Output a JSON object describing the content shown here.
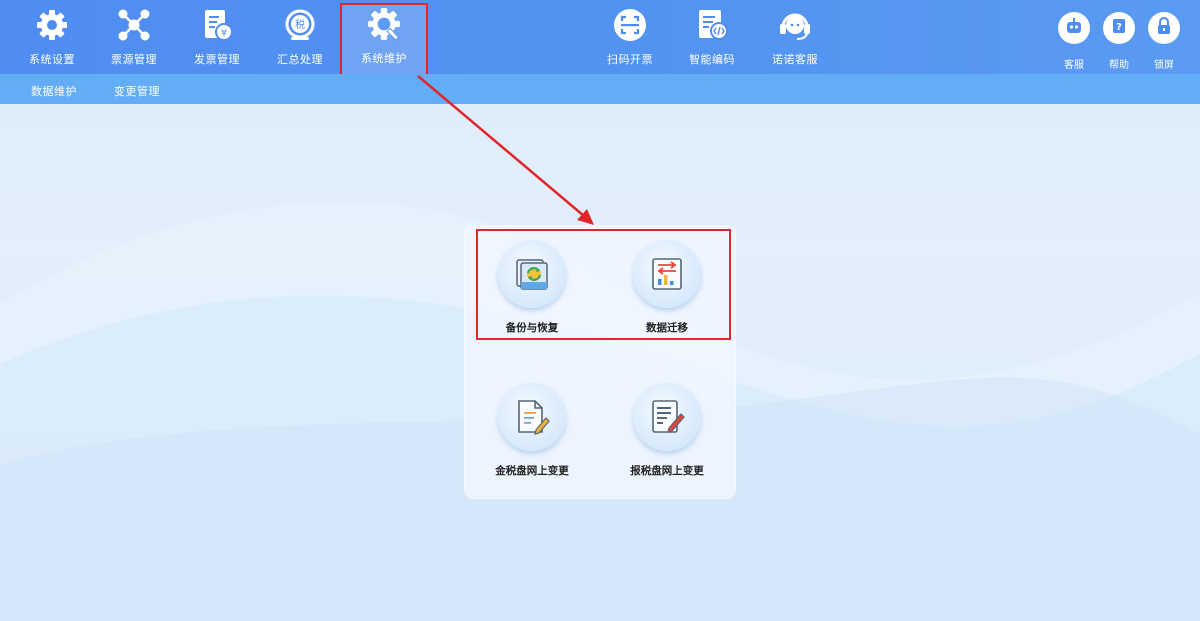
{
  "top_nav": {
    "items": [
      {
        "label": "系统设置",
        "icon": "gear-icon"
      },
      {
        "label": "票源管理",
        "icon": "network-icon"
      },
      {
        "label": "发票管理",
        "icon": "invoice-icon"
      },
      {
        "label": "汇总处理",
        "icon": "tax-summary-icon"
      },
      {
        "label": "系统维护",
        "icon": "wrench-gear-icon",
        "active": true
      },
      {
        "label": "扫码开票",
        "icon": "scan-icon"
      },
      {
        "label": "智能编码",
        "icon": "code-doc-icon"
      },
      {
        "label": "诺诺客服",
        "icon": "headset-icon"
      }
    ],
    "right_buttons": [
      {
        "label": "客服",
        "icon": "robot-icon"
      },
      {
        "label": "帮助",
        "icon": "help-icon"
      },
      {
        "label": "锁屏",
        "icon": "lock-icon"
      }
    ]
  },
  "sub_nav": {
    "items": [
      "数据维护",
      "变更管理"
    ]
  },
  "panel": {
    "tiles": [
      {
        "label": "备份与恢复",
        "icon": "backup-restore-icon"
      },
      {
        "label": "数据迁移",
        "icon": "data-migration-icon"
      },
      {
        "label": "金税盘网上变更",
        "icon": "document-edit-icon"
      },
      {
        "label": "报税盘网上变更",
        "icon": "form-edit-icon"
      }
    ]
  },
  "colors": {
    "nav_bg": "#4f8df0",
    "subnav_bg": "#62adf6",
    "highlight": "#e0262b"
  }
}
